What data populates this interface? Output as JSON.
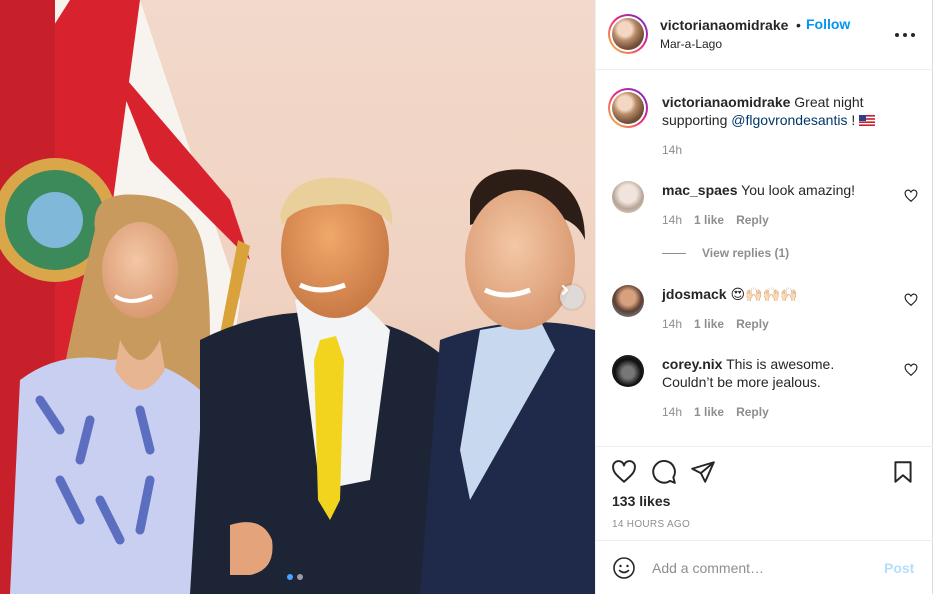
{
  "header": {
    "username": "victorianaomidrake",
    "separator": "•",
    "follow_label": "Follow",
    "location": "Mar-a-Lago",
    "more_label": "•••",
    "more_icon": "more-options-icon"
  },
  "caption": {
    "username": "victorianaomidrake",
    "text_before": "Great night supporting",
    "mention": "@flgovrondesantis",
    "text_after": "!",
    "emoji": "us-flag-emoji",
    "time": "14h"
  },
  "comments": [
    {
      "username": "mac_spaes",
      "text": "You look amazing!",
      "time": "14h",
      "likes": "1 like",
      "reply": "Reply"
    },
    {
      "username": "jdosmack",
      "text": "😍🙌🏻🙌🏻🙌🏻",
      "time": "14h",
      "likes": "1 like",
      "reply": "Reply"
    },
    {
      "username": "corey.nix",
      "text": "This is awesome. Couldn’t be more jealous.",
      "time": "14h",
      "likes": "1 like",
      "reply": "Reply"
    }
  ],
  "view_replies": "View replies (1)",
  "actions": {
    "like_icon": "heart-icon",
    "comment_icon": "comment-icon",
    "share_icon": "share-icon",
    "save_icon": "bookmark-icon",
    "likes": "133 likes",
    "posted": "14 HOURS AGO"
  },
  "add_comment": {
    "placeholder": "Add a comment…",
    "post_label": "Post",
    "emoji_icon": "smiley-icon"
  },
  "carousel": {
    "next_icon": "chevron-right-icon",
    "slide_count": 2,
    "active_index": 0
  },
  "colors": {
    "link_blue": "#0095f6",
    "mention_blue": "#00376b",
    "post_disabled": "#b2dffc",
    "muted": "#8e8e8e",
    "text": "#262626",
    "tie_yellow": "#f2d41e"
  }
}
